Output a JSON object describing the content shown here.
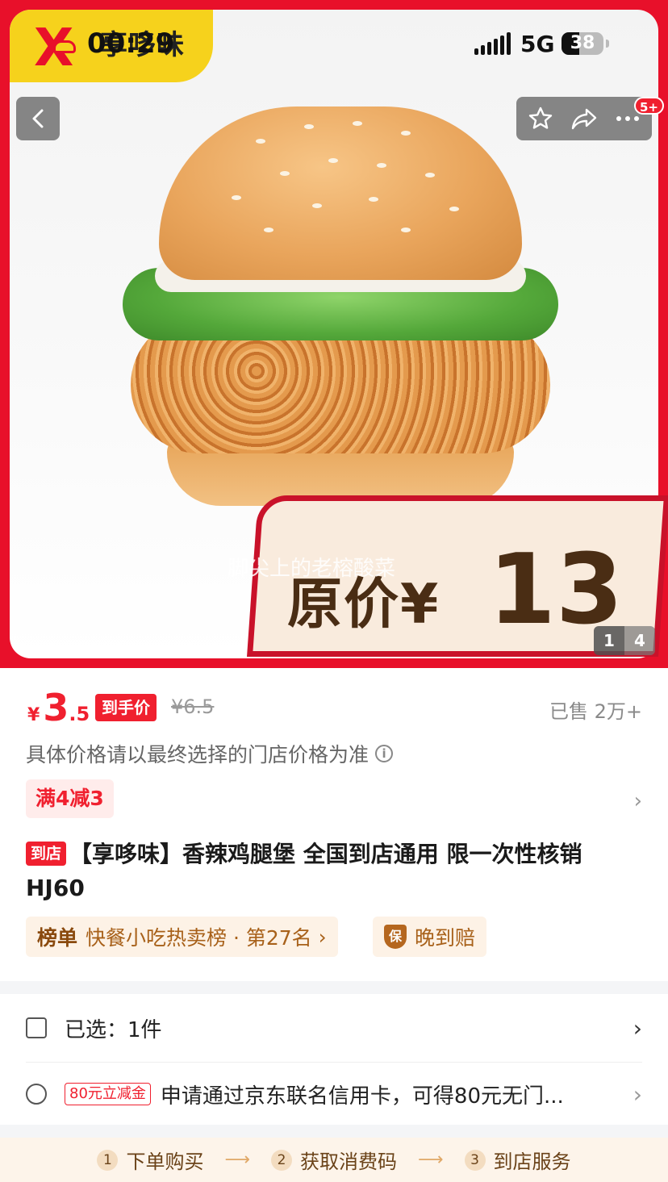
{
  "status": {
    "time": "00:29",
    "network": "5G",
    "battery": "38"
  },
  "brand": {
    "name": "享哆味",
    "sub": ""
  },
  "header": {
    "more_badge": "5+"
  },
  "hero": {
    "watermark": "脚尖上的老榕酸菜",
    "banner_label": "原价¥",
    "banner_value": "13",
    "page_current": "1",
    "page_total": "4"
  },
  "price": {
    "currency": "¥",
    "integer": "3",
    "decimal": ".5",
    "tag": "到手价",
    "original": "¥6.5",
    "sold": "已售 2万+"
  },
  "note": "具体价格请以最终选择的门店价格为准",
  "coupon": "满4减3",
  "product": {
    "store_tag": "到店",
    "title": "【享哆味】香辣鸡腿堡 全国到店通用 限一次性核销 HJ60"
  },
  "rank": {
    "head": "榜单",
    "text": "快餐小吃热卖榜 · 第27名"
  },
  "guarantee": {
    "icon": "保",
    "text": "晚到赔"
  },
  "selected": {
    "label": "已选：1件"
  },
  "promo": {
    "tag": "80元立减金",
    "text": "申请通过京东联名信用卡，可得80元无门..."
  },
  "steps": [
    {
      "num": "1",
      "label": "下单购买"
    },
    {
      "num": "2",
      "label": "获取消费码"
    },
    {
      "num": "3",
      "label": "到店服务"
    }
  ],
  "colors": {
    "brand_red": "#e8102a",
    "price_red": "#f0202f",
    "brand_yellow": "#f6d21c"
  }
}
